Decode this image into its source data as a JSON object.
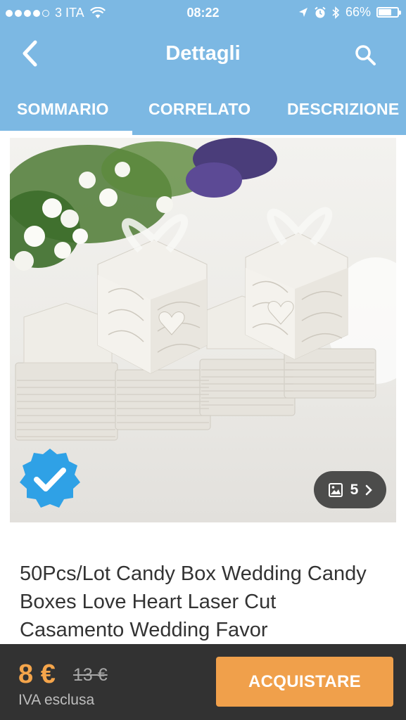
{
  "status_bar": {
    "carrier": "3 ITA",
    "time": "08:22",
    "battery": "66%",
    "battery_level": 0.66
  },
  "nav": {
    "title": "Dettagli",
    "back_icon": "chevron-left-icon",
    "search_icon": "search-icon"
  },
  "tabs": [
    {
      "label": "SOMMARIO",
      "active": true
    },
    {
      "label": "CORRELATO",
      "active": false
    },
    {
      "label": "DESCRIZIONE",
      "active": false
    }
  ],
  "gallery": {
    "count": "5",
    "icon": "image-icon"
  },
  "product": {
    "title": "50Pcs/Lot Candy Box Wedding Candy Boxes Love Heart Laser Cut Casamento Wedding Favor"
  },
  "pricing": {
    "price": "8 €",
    "old_price": "13 €",
    "vat_note": "IVA esclusa",
    "buy_label": "ACQUISTARE"
  },
  "colors": {
    "header": "#7cb8e3",
    "accent": "#f0a04b",
    "bottom_bar": "#323232",
    "badge": "#2fa1e6"
  }
}
